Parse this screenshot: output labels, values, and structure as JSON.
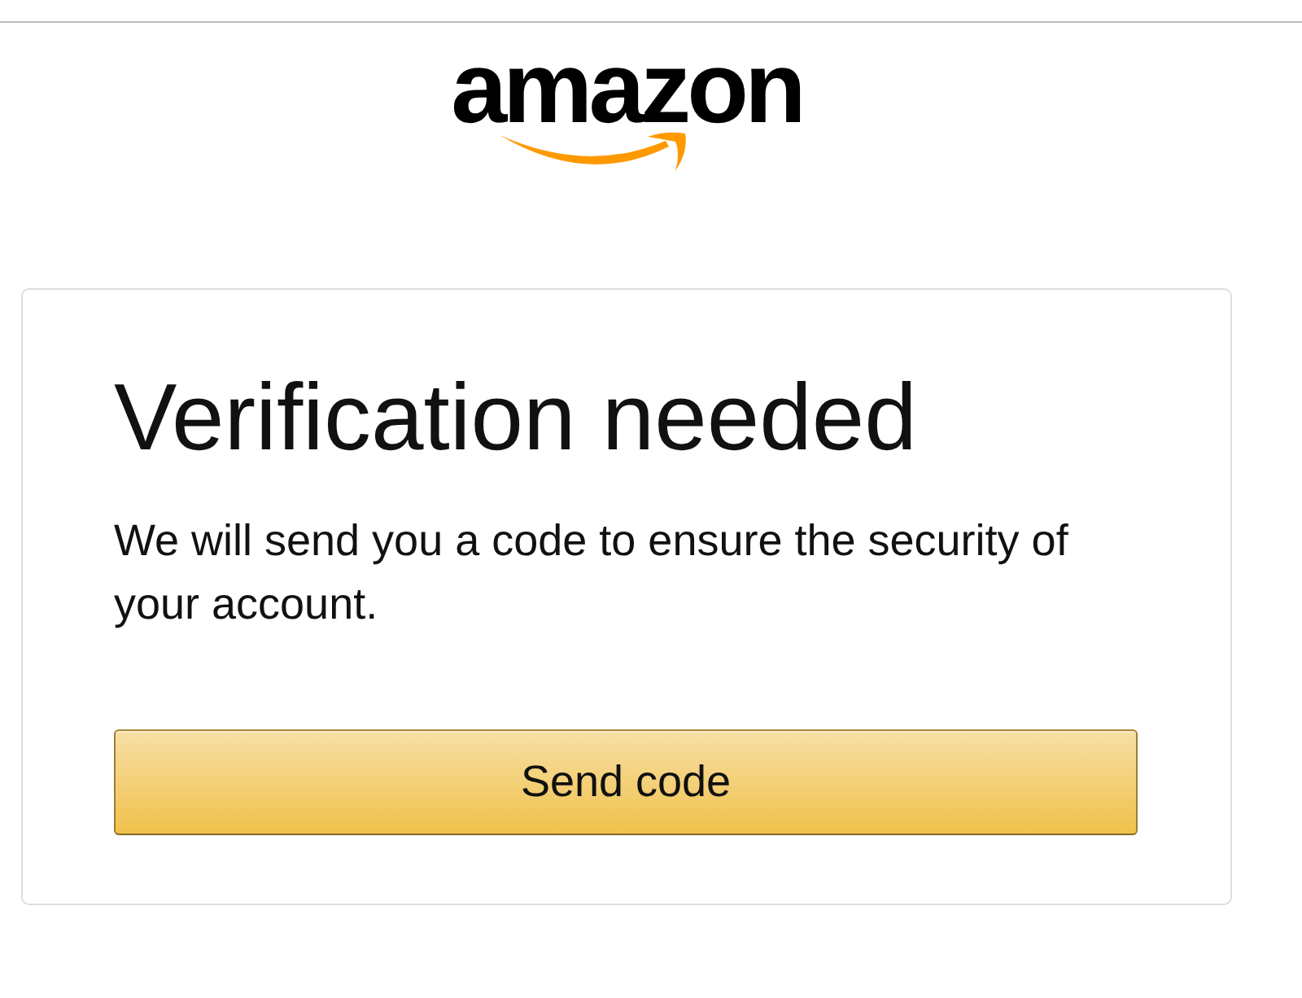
{
  "logo": {
    "text": "amazon"
  },
  "card": {
    "title": "Verification needed",
    "message": "We will send you a code to ensure the security of your account.",
    "button": {
      "label": "Send code"
    }
  }
}
